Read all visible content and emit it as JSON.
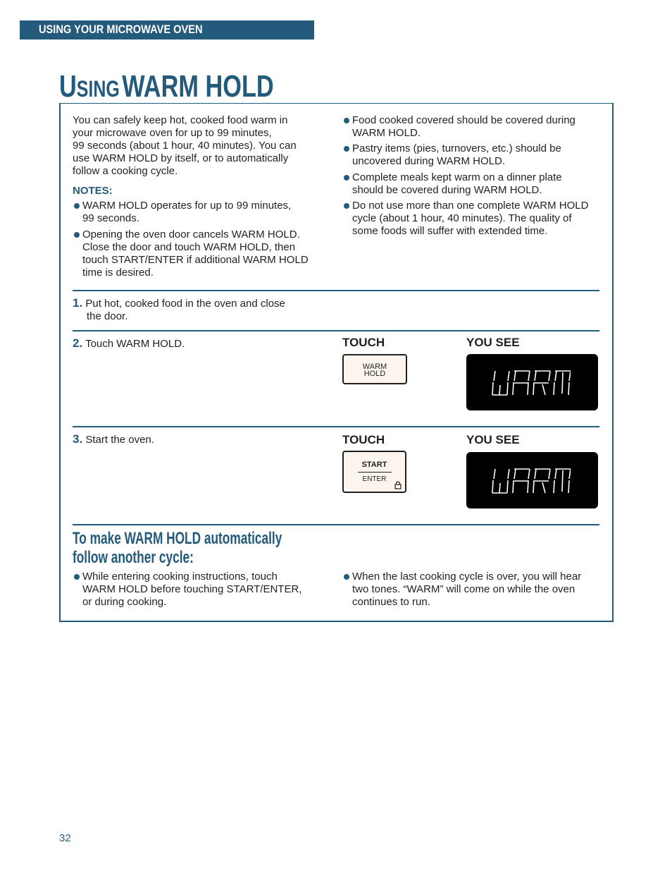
{
  "header": {
    "section": "USING YOUR MICROWAVE OVEN"
  },
  "title": {
    "first_letter": "U",
    "rest_small": "SING",
    "main": "WARM HOLD"
  },
  "intro": {
    "lines": [
      "You can safely keep hot, cooked food warm in",
      "your microwave oven for up to 99 minutes,",
      "99 seconds (about 1 hour, 40 minutes). You can",
      "use WARM HOLD by itself, or to automatically",
      "follow a cooking cycle."
    ]
  },
  "notes": {
    "label": "NOTES:",
    "items": [
      [
        "WARM HOLD operates for up to 99 minutes,",
        "99 seconds."
      ],
      [
        "Opening the oven door cancels WARM HOLD.",
        "Close the door and touch WARM HOLD, then",
        "touch START/ENTER if additional WARM HOLD",
        "time is desired."
      ]
    ]
  },
  "tips": {
    "items": [
      [
        "Food cooked covered should be covered during",
        "WARM HOLD."
      ],
      [
        "Pastry items (pies, turnovers, etc.) should be",
        "uncovered during WARM HOLD."
      ],
      [
        "Complete meals kept warm on a dinner plate",
        "should be covered during WARM HOLD."
      ],
      [
        "Do not use more than one complete WARM HOLD",
        "cycle (about 1 hour, 40 minutes). The quality of",
        "some foods will suffer with extended time."
      ]
    ]
  },
  "steps": [
    {
      "num": "1.",
      "lines": [
        "Put hot, cooked food in the oven and close",
        "the door."
      ]
    },
    {
      "num": "2.",
      "lines": [
        "Touch WARM HOLD."
      ],
      "touch_label": "TOUCH",
      "see_label": "YOU SEE",
      "key": [
        "WARM",
        "HOLD"
      ],
      "display": "WARM"
    },
    {
      "num": "3.",
      "lines": [
        "Start the oven."
      ],
      "touch_label": "TOUCH",
      "see_label": "YOU SEE",
      "key": [
        "START",
        "ENTER"
      ],
      "display": "WARM"
    }
  ],
  "auto": {
    "heading": [
      "To make WARM HOLD automatically",
      "follow another cycle:"
    ],
    "left": [
      "While entering cooking instructions, touch",
      "WARM HOLD before touching START/ENTER,",
      "or during cooking."
    ],
    "right": [
      "When the last cooking cycle is over, you will hear",
      "two tones. “WARM” will come on while the oven",
      "continues to run."
    ]
  },
  "page_number": "32",
  "colors": {
    "accent": "#245a7c",
    "key_fill": "#fbf5ee",
    "display_bg": "#000000"
  }
}
